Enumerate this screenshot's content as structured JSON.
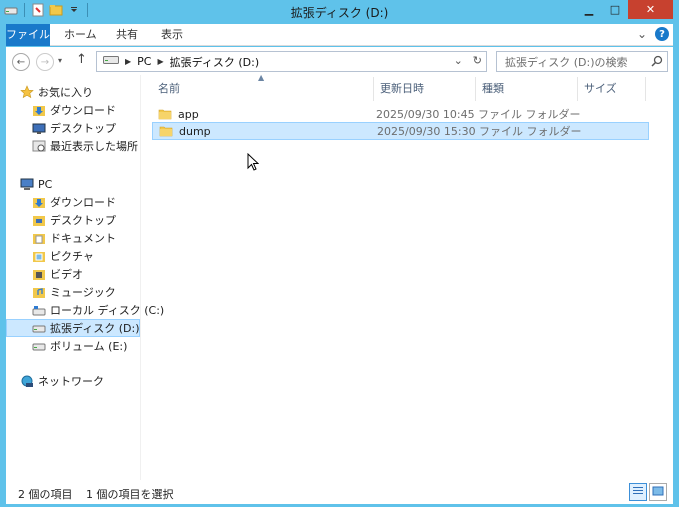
{
  "window": {
    "title": "拡張ディスク (D:)",
    "minimize": "▁",
    "maximize": "□",
    "close": "✕"
  },
  "ribbon": {
    "tabs": [
      "ファイル",
      "ホーム",
      "共有",
      "表示"
    ],
    "expand": "⌄",
    "help": "?"
  },
  "address": {
    "segments": [
      "PC",
      "拡張ディスク (D:)"
    ],
    "dropdown": "⌄",
    "refresh": "↻"
  },
  "search": {
    "placeholder": "拡張ディスク (D:)の検索"
  },
  "navpane": {
    "favorites": {
      "label": "お気に入り",
      "items": [
        "ダウンロード",
        "デスクトップ",
        "最近表示した場所"
      ]
    },
    "pc": {
      "label": "PC",
      "items": [
        "ダウンロード",
        "デスクトップ",
        "ドキュメント",
        "ピクチャ",
        "ビデオ",
        "ミュージック",
        "ローカル ディスク (C:)",
        "拡張ディスク (D:)",
        "ボリューム (E:)"
      ]
    },
    "network": {
      "label": "ネットワーク"
    }
  },
  "columns": {
    "name": "名前",
    "date": "更新日時",
    "type": "種類",
    "size": "サイズ"
  },
  "files": [
    {
      "name": "app",
      "date": "2025/09/30 10:45",
      "type": "ファイル フォルダー"
    },
    {
      "name": "dump",
      "date": "2025/09/30 15:30",
      "type": "ファイル フォルダー"
    }
  ],
  "status": {
    "count": "2 個の項目",
    "selected": "1 個の項目を選択"
  },
  "colors": {
    "accent": "#1979ca",
    "titlebar": "#5fc2ea",
    "selection": "#cce8ff",
    "close": "#c7412f"
  }
}
